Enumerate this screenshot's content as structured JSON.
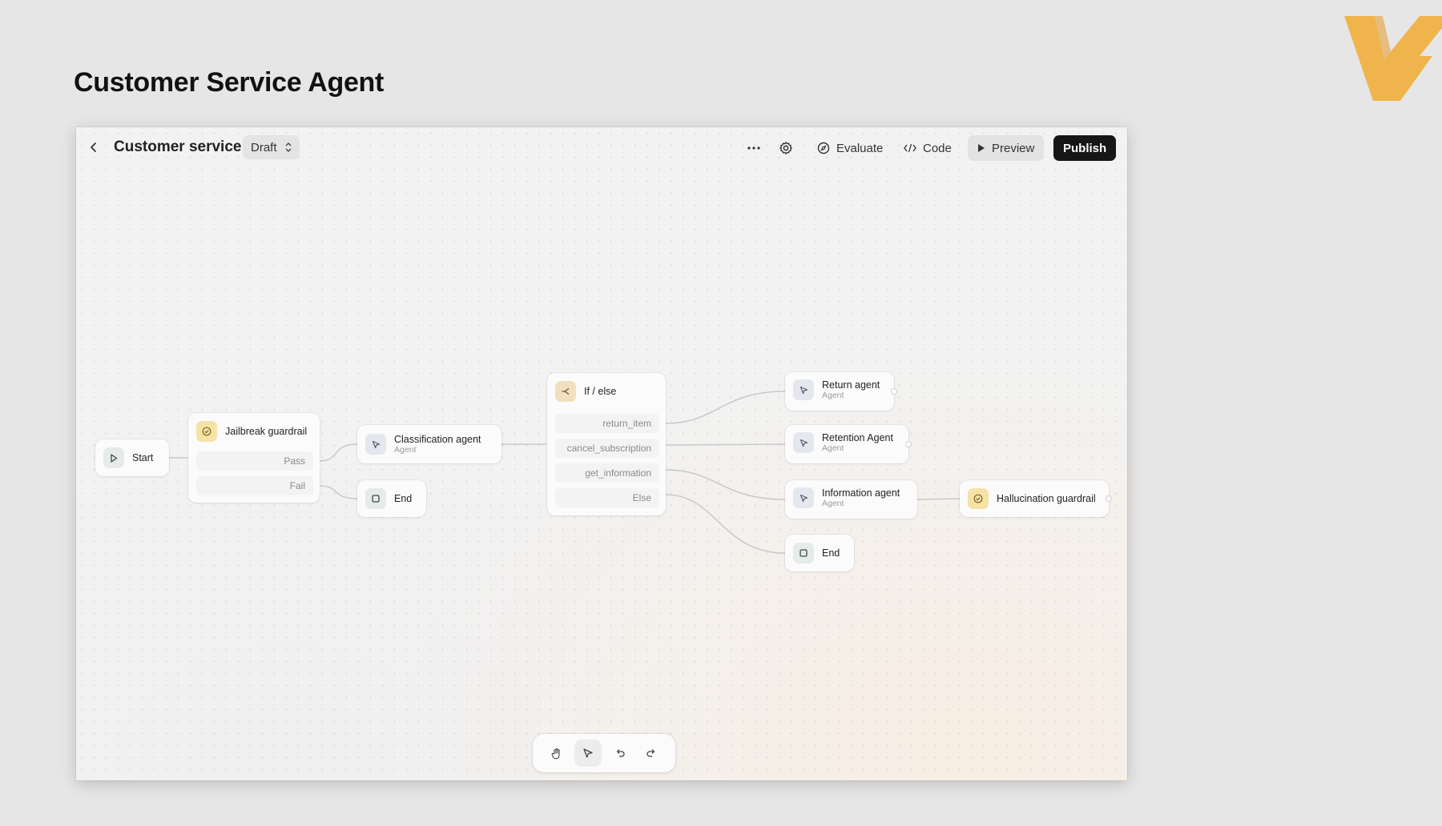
{
  "slide": {
    "title": "Customer Service Agent"
  },
  "brand": {
    "accent_color": "#f0b44c",
    "logo_icon": "v-logo-icon"
  },
  "topbar": {
    "back_icon": "chevron-left-icon",
    "workflow_title": "Customer service",
    "status_select": "Draft",
    "more_icon": "more-horizontal-icon",
    "settings_icon": "gear-icon",
    "evaluate_label": "Evaluate",
    "code_label": "Code",
    "preview_label": "Preview",
    "publish_label": "Publish"
  },
  "nodes": {
    "start": {
      "title": "Start"
    },
    "jailbreak": {
      "title": "Jailbreak guardrail",
      "outputs": [
        "Pass",
        "Fail"
      ]
    },
    "classification": {
      "title": "Classification agent",
      "subtitle": "Agent"
    },
    "end1": {
      "title": "End"
    },
    "ifelse": {
      "title": "If / else",
      "conditions": [
        "return_item",
        "cancel_subscription",
        "get_information",
        "Else"
      ]
    },
    "return_agent": {
      "title": "Return agent",
      "subtitle": "Agent"
    },
    "retention_agent": {
      "title": "Retention Agent",
      "subtitle": "Agent"
    },
    "information_agent": {
      "title": "Information agent",
      "subtitle": "Agent"
    },
    "end2": {
      "title": "End"
    },
    "hallucination": {
      "title": "Hallucination guardrail"
    }
  },
  "bottom_toolbar": {
    "tools": [
      "hand-icon",
      "pointer-icon",
      "undo-icon",
      "redo-icon"
    ],
    "active_tool": "pointer-icon"
  }
}
